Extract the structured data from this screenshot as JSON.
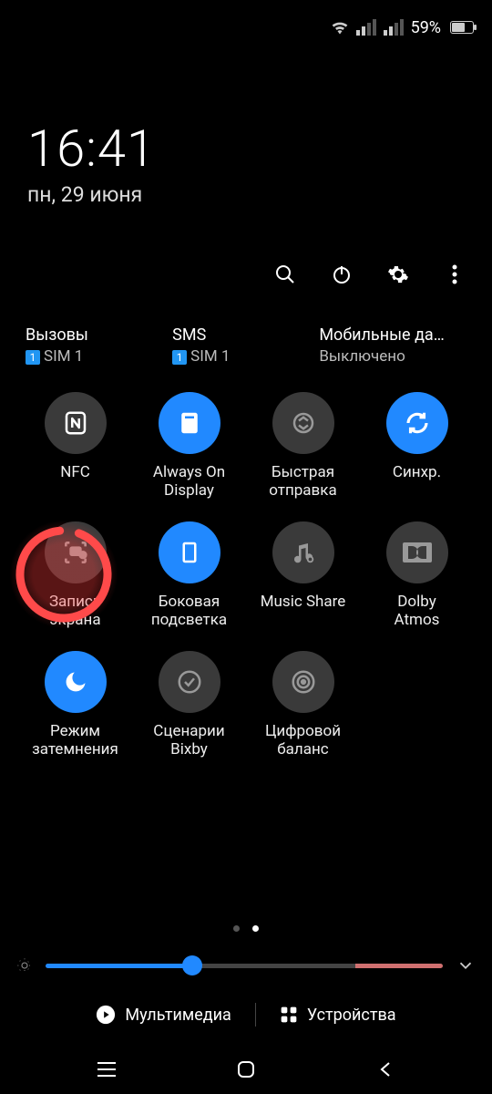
{
  "status": {
    "battery_pct": "59%"
  },
  "clock": {
    "time": "16:41",
    "date": "пн, 29 июня"
  },
  "sim_columns": [
    {
      "title": "Вызовы",
      "badge": "1",
      "sub": "SIM 1"
    },
    {
      "title": "SMS",
      "badge": "1",
      "sub": "SIM 1"
    },
    {
      "title": "Мобильные да…",
      "badge": "",
      "sub": "Выключено"
    }
  ],
  "tiles": [
    {
      "key": "nfc",
      "label": "NFC",
      "on": false,
      "icon": "nfc"
    },
    {
      "key": "aod",
      "label": "Always On\nDisplay",
      "on": true,
      "icon": "aod"
    },
    {
      "key": "quickshare",
      "label": "Быстрая\nотправка",
      "on": false,
      "icon": "quickshare"
    },
    {
      "key": "sync",
      "label": "Синхр.",
      "on": true,
      "icon": "sync"
    },
    {
      "key": "screenrec",
      "label": "Запись\nэкрана",
      "on": false,
      "icon": "screenrec"
    },
    {
      "key": "edge",
      "label": "Боковая\nподсветка",
      "on": true,
      "icon": "edge"
    },
    {
      "key": "musicshare",
      "label": "Music Share",
      "on": false,
      "icon": "musicshare"
    },
    {
      "key": "dolby",
      "label": "Dolby\nAtmos",
      "on": false,
      "icon": "dolby"
    },
    {
      "key": "darkmode",
      "label": "Режим\nзатемнения",
      "on": true,
      "icon": "moon"
    },
    {
      "key": "bixby",
      "label": "Сценарии\nBixby",
      "on": false,
      "icon": "bixby"
    },
    {
      "key": "wellbeing",
      "label": "Цифровой\nбаланс",
      "on": false,
      "icon": "target"
    }
  ],
  "bottom": {
    "media": "Мультимедиа",
    "devices": "Устройства"
  },
  "page_index": 1,
  "page_count": 2
}
